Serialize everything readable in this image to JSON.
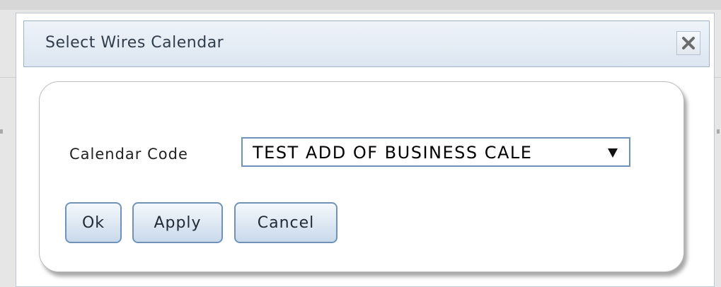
{
  "dialog": {
    "title": "Select Wires Calendar",
    "close_icon": "close-icon"
  },
  "form": {
    "calendar_code_label": "Calendar Code",
    "calendar_code_value": "TEST ADD OF BUSINESS CALE"
  },
  "buttons": {
    "ok": "Ok",
    "apply": "Apply",
    "cancel": "Cancel"
  },
  "colors": {
    "titlebar": "#dce6f1",
    "button_border": "#6f93b8"
  }
}
